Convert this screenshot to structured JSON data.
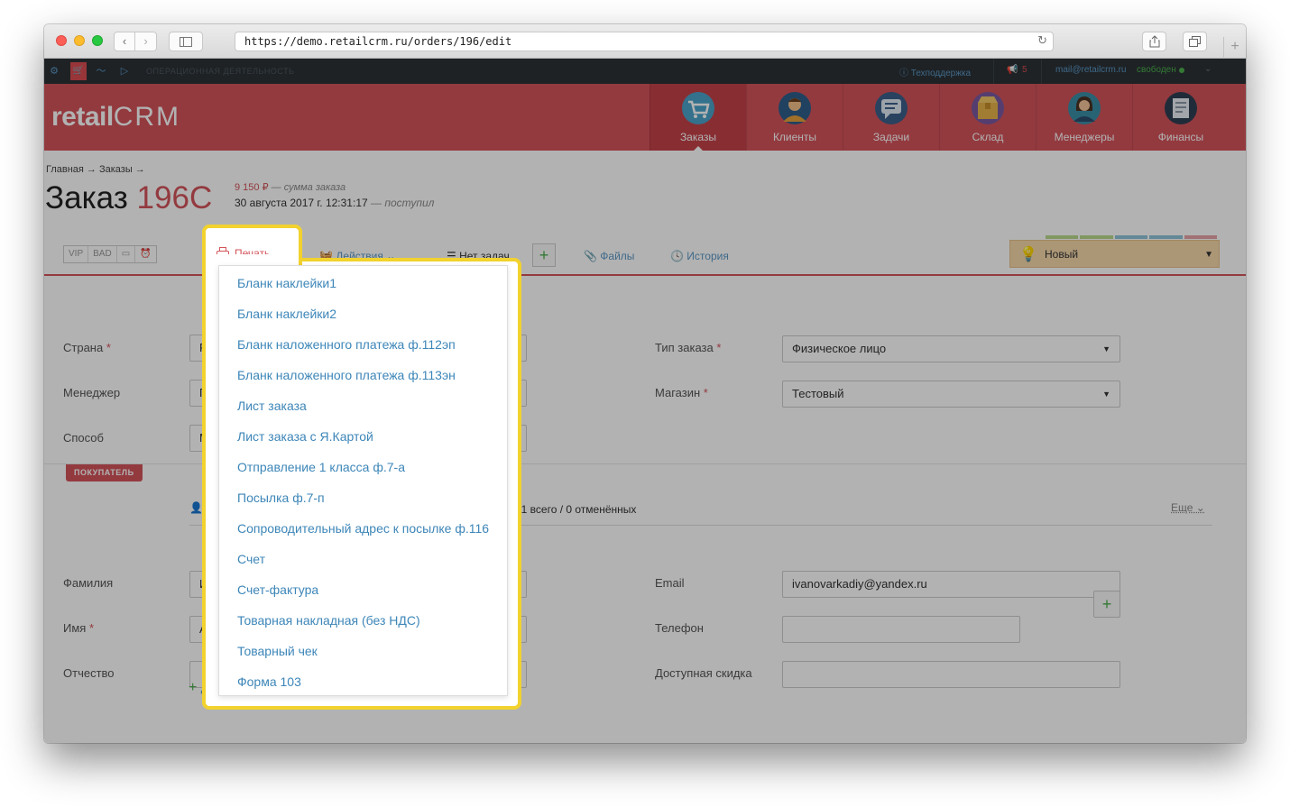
{
  "browser": {
    "url": "https://demo.retailcrm.ru/orders/196/edit"
  },
  "topstrip": {
    "section": "Операционная деятельность",
    "support": "Техподдержка",
    "notifications": "5",
    "email": "mail@retailcrm.ru",
    "status": "свободен"
  },
  "header": {
    "logo_text": "retail",
    "logo_crm": "CRM",
    "nav": [
      {
        "label": "Заказы",
        "icon": "orders-cart-icon"
      },
      {
        "label": "Клиенты",
        "icon": "clients-person-icon"
      },
      {
        "label": "Задачи",
        "icon": "tasks-chat-icon"
      },
      {
        "label": "Склад",
        "icon": "warehouse-box-icon"
      },
      {
        "label": "Менеджеры",
        "icon": "managers-person-icon"
      },
      {
        "label": "Финансы",
        "icon": "finance-doc-icon"
      }
    ]
  },
  "order": {
    "breadcrumb": "Главная → Заказы →",
    "title_prefix": "Заказ",
    "number": "196C",
    "sum": "9 150 ₽",
    "sum_note": "— сумма заказа",
    "date": "30 августа 2017 г. 12:31:17",
    "date_note": "— поступил"
  },
  "toolbar": {
    "tags": [
      "VIP",
      "BAD"
    ],
    "print": "Печать",
    "actions": "Действия",
    "tasks": "Нет задач",
    "files": "Файлы",
    "history": "История",
    "status": "Новый",
    "status_colors": [
      "#b9d98b",
      "#b9d98b",
      "#8fc5d9",
      "#8fc5d9",
      "#e8a3a6"
    ]
  },
  "form": {
    "country_label": "Страна",
    "country_value": "Рос",
    "manager_label": "Менеджер",
    "manager_value": "Пло",
    "method_label": "Способ",
    "method_value": "Моб",
    "order_type_label": "Тип заказа",
    "order_type_value": "Физическое лицо",
    "shop_label": "Магазин",
    "shop_value": "Тестовый"
  },
  "buyer": {
    "tag": "ПОКУПАТЕЛЬ",
    "link": "Пр",
    "stats": ": 1 всего / 0 отменённых",
    "more": "Еще",
    "lastname_label": "Фамилия",
    "lastname_value": "Ива",
    "firstname_label": "Имя",
    "firstname_value": "Арк",
    "patronymic_label": "Отчество",
    "email_label": "Email",
    "email_value": "ivanovarkadiy@yandex.ru",
    "phone_label": "Телефон",
    "discount_label": "Доступная скидка",
    "add_more": "Доп"
  },
  "print_menu": {
    "items": [
      "Бланк наклейки1",
      "Бланк наклейки2",
      "Бланк наложенного платежа ф.112эп",
      "Бланк наложенного платежа ф.113эн",
      "Лист заказа",
      "Лист заказа с Я.Картой",
      "Отправление 1 класса ф.7-а",
      "Посылка ф.7-п",
      "Сопроводительный адрес к посылке ф.116",
      "Счет",
      "Счет-фактура",
      "Товарная накладная (без НДС)",
      "Товарный чек",
      "Форма 103"
    ]
  },
  "colors": {
    "brand_red": "#d3545b",
    "highlight_yellow": "#f2d22e",
    "link_blue": "#3d86b8"
  }
}
